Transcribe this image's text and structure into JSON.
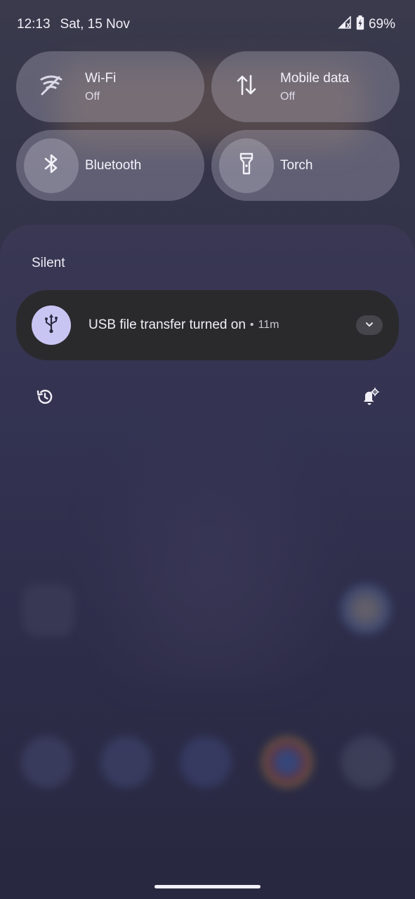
{
  "status_bar": {
    "time": "12:13",
    "date": "Sat, 15 Nov",
    "battery": "69%"
  },
  "quick_settings": {
    "tiles": [
      {
        "label": "Wi-Fi",
        "state": "Off",
        "icon": "wifi-icon"
      },
      {
        "label": "Mobile data",
        "state": "Off",
        "icon": "mobile-data-icon"
      },
      {
        "label": "Bluetooth",
        "icon": "bluetooth-icon"
      },
      {
        "label": "Torch",
        "icon": "torch-icon"
      }
    ]
  },
  "notifications": {
    "section_title": "Silent",
    "items": [
      {
        "title": "USB file transfer turned on",
        "time": "11m",
        "icon": "usb-icon"
      }
    ]
  },
  "colors": {
    "notification_bg": "#2a2a2d",
    "usb_icon_bg": "#c9c5f3",
    "tile_bg": "rgba(190,186,206,0.32)"
  }
}
